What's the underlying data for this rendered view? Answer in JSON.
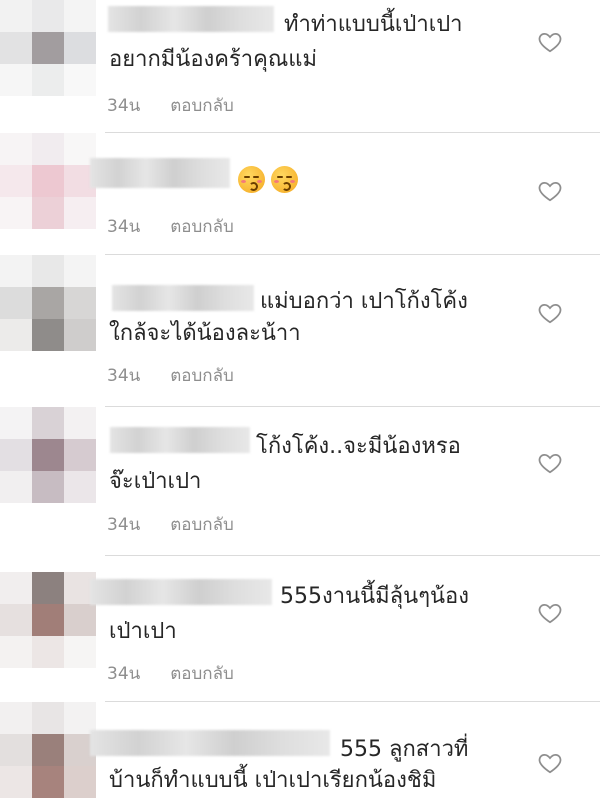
{
  "comments": [
    {
      "lines": [
        "ทำท่าแบบนี้เป่าเปา",
        "อยากมีน้องคร้าคุณแม่"
      ],
      "time": "34น",
      "reply": "ตอบกลับ",
      "emojis": []
    },
    {
      "lines": [
        ""
      ],
      "time": "34น",
      "reply": "ตอบกลับ",
      "emojis": [
        "kissing-face-emoji",
        "kissing-face-emoji"
      ]
    },
    {
      "lines": [
        "แม่บอกว่า เปาโก้งโค้ง",
        "ใกล้จะได้น้องละน้าา"
      ],
      "time": "34น",
      "reply": "ตอบกลับ",
      "emojis": []
    },
    {
      "lines": [
        "โก้งโค้ง..จะมีน้องหรอ",
        "จ๊ะเป่าเปา"
      ],
      "time": "34น",
      "reply": "ตอบกลับ",
      "emojis": []
    },
    {
      "lines": [
        "555งานนี้มีลุ้นๆน้อง",
        "เป่าเปา"
      ],
      "time": "34น",
      "reply": "ตอบกลับ",
      "emojis": []
    },
    {
      "lines": [
        "555 ลูกสาวที่",
        "บ้านก็ทำแบบนี้ เป่าเปาเรียกน้องชิมิ"
      ],
      "time": "",
      "reply": "",
      "emojis": []
    }
  ],
  "colors": {
    "text": "#262626",
    "meta": "#8e8e8e",
    "divider": "#dbdbdb",
    "heart": "#8e8e8e"
  },
  "icons": [
    "heart-icon"
  ]
}
